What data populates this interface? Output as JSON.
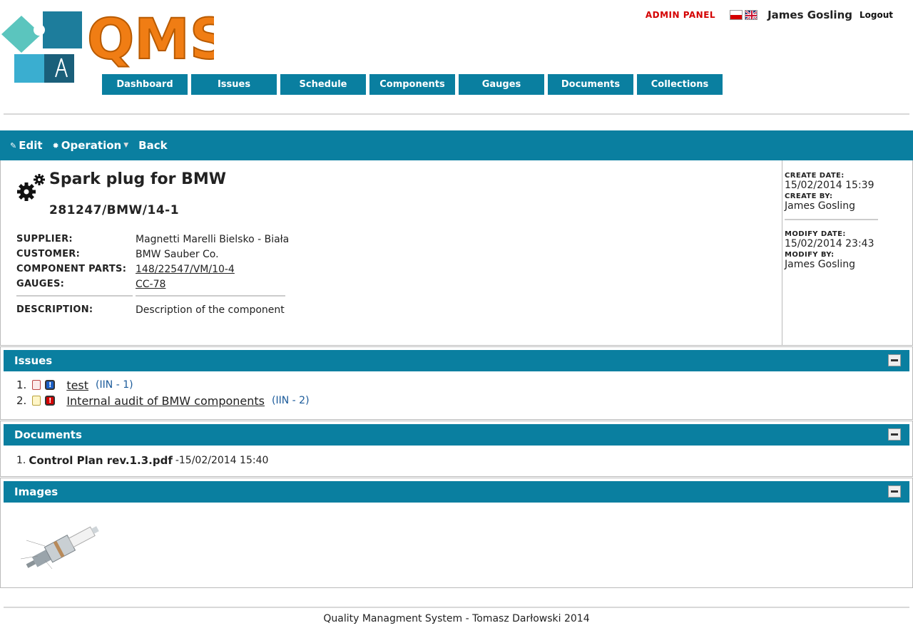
{
  "header": {
    "logo_text": "QMS",
    "admin_panel": "ADMIN PANEL",
    "user_name": "James Gosling",
    "logout": "Logout"
  },
  "nav": [
    "Dashboard",
    "Issues",
    "Schedule",
    "Components",
    "Gauges",
    "Documents",
    "Collections"
  ],
  "toolbar": {
    "edit": "Edit",
    "operation": "Operation",
    "back": "Back"
  },
  "component": {
    "name": "Spark plug for BMW",
    "code": "281247/BMW/14-1",
    "supplier_label": "SUPPLIER:",
    "supplier": "Magnetti Marelli Bielsko - Biała",
    "customer_label": "CUSTOMER:",
    "customer": "BMW Sauber Co.",
    "parts_label": "COMPONENT PARTS:",
    "parts": "148/22547/VM/10-4",
    "gauges_label": "GAUGES:",
    "gauges": "CC-78",
    "description_label": "DESCRIPTION:",
    "description": "Description of the component"
  },
  "meta": {
    "create_date_label": "CREATE DATE:",
    "create_date": "15/02/2014 15:39",
    "create_by_label": "CREATE BY:",
    "create_by": "James Gosling",
    "modify_date_label": "MODIFY DATE:",
    "modify_date": "15/02/2014 23:43",
    "modify_by_label": "MODIFY BY:",
    "modify_by": "James Gosling"
  },
  "issues": {
    "title": "Issues",
    "items": [
      {
        "index": "1.",
        "title": "test",
        "number": "(IIN - 1)"
      },
      {
        "index": "2.",
        "title": "Internal audit of BMW components",
        "number": "(IIN - 2)"
      }
    ]
  },
  "documents": {
    "title": "Documents",
    "items": [
      {
        "index": "1.",
        "name": "Control Plan rev.1.3.pdf",
        "date": "-15/02/2014 15:40"
      }
    ]
  },
  "images": {
    "title": "Images"
  },
  "footer": "Quality Managment System - Tomasz Darłowski 2014",
  "colors": {
    "accent": "#0a7fa0",
    "admin": "#d40000",
    "logo_orange": "#f07d14"
  }
}
